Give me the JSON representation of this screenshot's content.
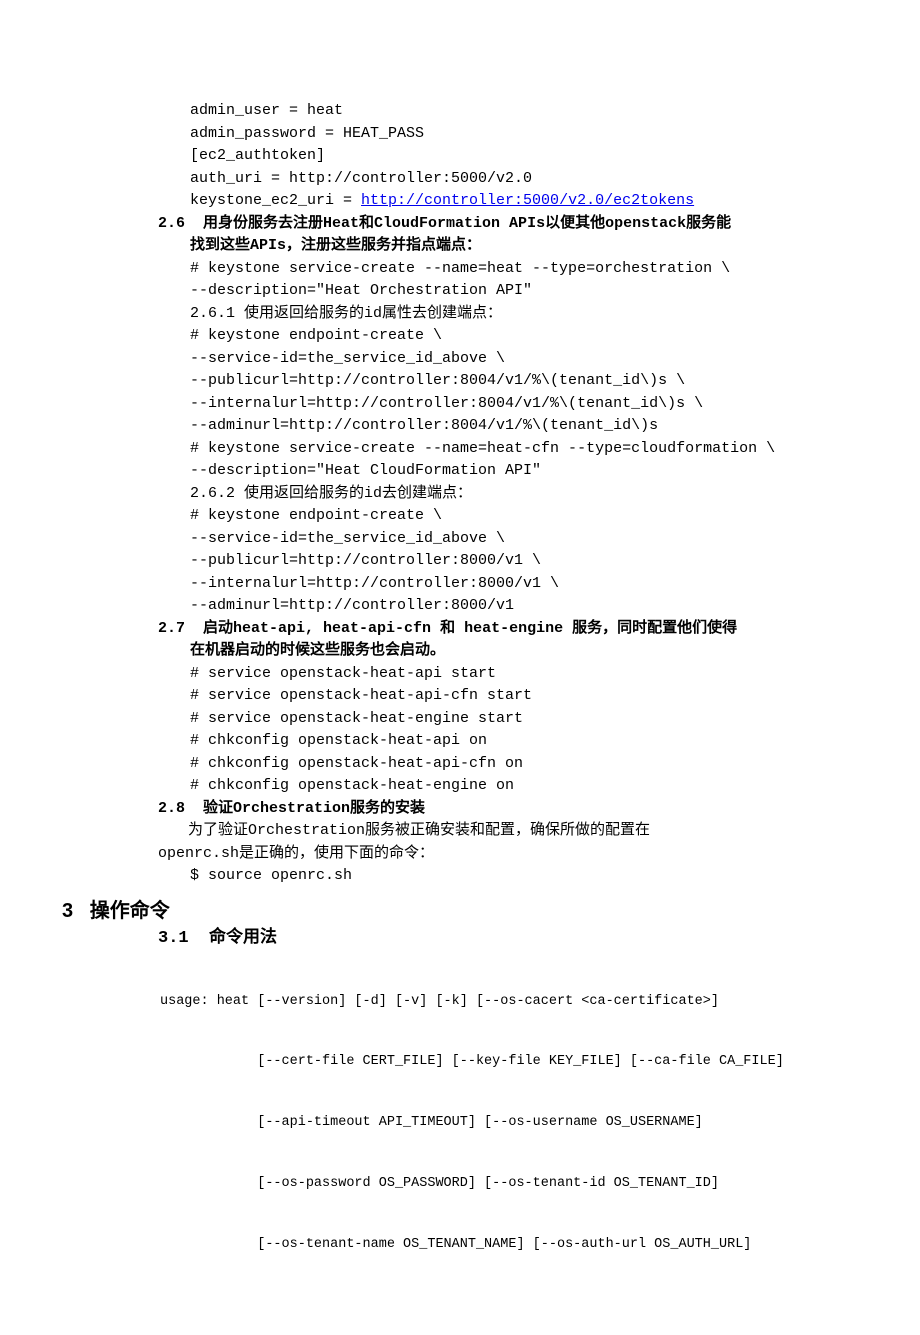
{
  "pre_lines": [
    "admin_user = heat",
    "admin_password = HEAT_PASS",
    "[ec2_authtoken]",
    "auth_uri = http://controller:5000/v2.0"
  ],
  "keystone_line_prefix": "keystone_ec2_uri = ",
  "keystone_link": "http://controller:5000/v2.0/ec2tokens",
  "sec26_num": "2.6",
  "sec26_title_l1": "用身份服务去注册Heat和CloudFormation APIs以便其他openstack服务能",
  "sec26_title_l2": "找到这些APIs，注册这些服务并指点端点：",
  "sec26_block1": [
    "# keystone service-create --name=heat --type=orchestration \\",
    "--description=\"Heat Orchestration API\""
  ],
  "sec261": "2.6.1 使用返回给服务的id属性去创建端点：",
  "sec261_block": [
    "# keystone endpoint-create \\",
    "--service-id=the_service_id_above \\",
    "--publicurl=http://controller:8004/v1/%\\(tenant_id\\)s \\",
    "--internalurl=http://controller:8004/v1/%\\(tenant_id\\)s \\",
    "--adminurl=http://controller:8004/v1/%\\(tenant_id\\)s",
    "# keystone service-create --name=heat-cfn --type=cloudformation \\",
    "--description=\"Heat CloudFormation API\""
  ],
  "sec262": "2.6.2 使用返回给服务的id去创建端点：",
  "sec262_block": [
    "# keystone endpoint-create \\",
    "--service-id=the_service_id_above \\",
    "--publicurl=http://controller:8000/v1 \\",
    "--internalurl=http://controller:8000/v1 \\",
    "--adminurl=http://controller:8000/v1"
  ],
  "sec27_num": "2.7",
  "sec27_title_l1": "启动heat-api, heat-api-cfn 和 heat-engine 服务，同时配置他们使得",
  "sec27_title_l2": "在机器启动的时候这些服务也会启动。",
  "sec27_block": [
    "# service openstack-heat-api start",
    "# service openstack-heat-api-cfn start",
    "# service openstack-heat-engine start",
    "# chkconfig openstack-heat-api on",
    "# chkconfig openstack-heat-api-cfn on",
    "# chkconfig openstack-heat-engine on"
  ],
  "sec28_num": "2.8",
  "sec28_title": "验证Orchestration服务的安装",
  "sec28_body1": "为了验证Orchestration服务被正确安装和配置，确保所做的配置在",
  "sec28_body2": "openrc.sh是正确的，使用下面的命令：",
  "sec28_cmd": "$ source openrc.sh",
  "h3_num": "3",
  "h3_title": "操作命令",
  "sec31_num": "3.1",
  "sec31_title": "命令用法",
  "usage": [
    "usage: heat [--version] [-d] [-v] [-k] [--os-cacert <ca-certificate>]",
    "            [--cert-file CERT_FILE] [--key-file KEY_FILE] [--ca-file CA_FILE]",
    "            [--api-timeout API_TIMEOUT] [--os-username OS_USERNAME]",
    "            [--os-password OS_PASSWORD] [--os-tenant-id OS_TENANT_ID]",
    "            [--os-tenant-name OS_TENANT_NAME] [--os-auth-url OS_AUTH_URL]"
  ]
}
